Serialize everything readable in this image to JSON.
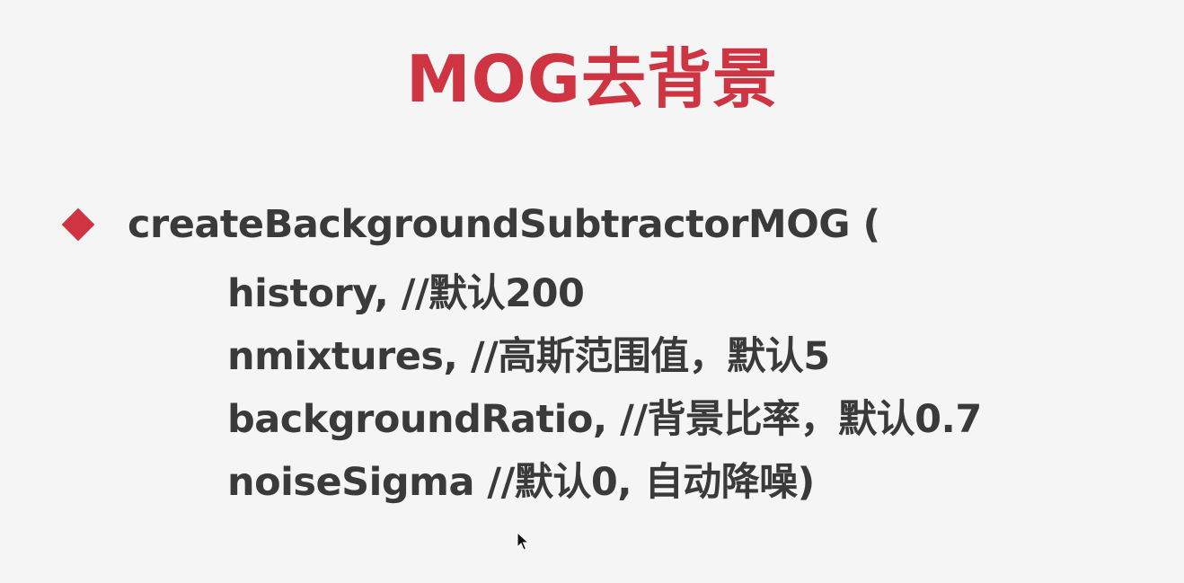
{
  "slide": {
    "title": "MOG去背景",
    "function_line": "createBackgroundSubtractorMOG (",
    "params": [
      "history, //默认200",
      "nmixtures,  //高斯范围值，默认5",
      "backgroundRatio, //背景比率，默认0.7",
      "noiseSigma //默认0, 自动降噪)"
    ],
    "colors": {
      "accent": "#cf3443",
      "text": "#3a3a3a",
      "background": "#f5f5f5"
    }
  },
  "icons": {
    "bullet": "diamond-bullet-icon",
    "pointer": "mouse-cursor-icon"
  }
}
